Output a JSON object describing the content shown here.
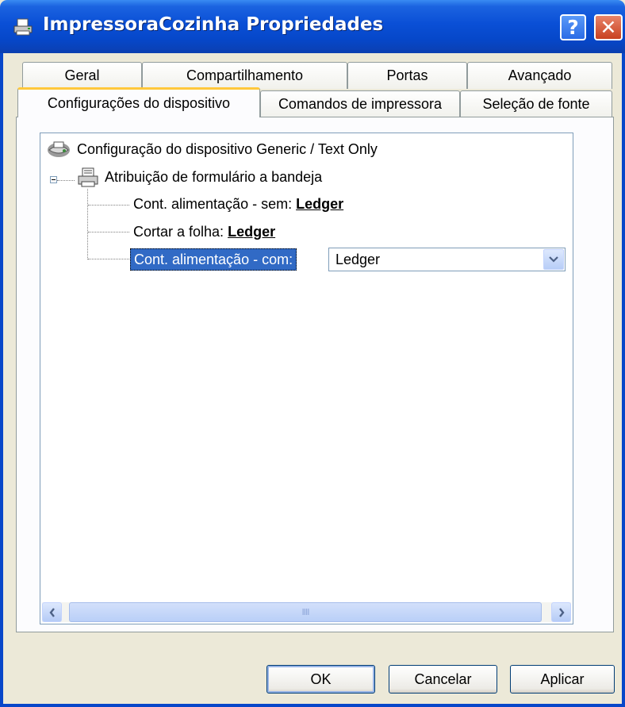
{
  "window": {
    "title": "ImpressoraCozinha Propriedades",
    "help_label": "?",
    "close_label": "✕"
  },
  "tabs": {
    "row_back": [
      {
        "label": "Geral"
      },
      {
        "label": "Compartilhamento"
      },
      {
        "label": "Portas"
      },
      {
        "label": "Avançado"
      }
    ],
    "row_front": [
      {
        "label": "Configurações do dispositivo",
        "active": true
      },
      {
        "label": "Comandos de impressora"
      },
      {
        "label": "Seleção de fonte"
      }
    ]
  },
  "tree": {
    "root": "Configuração do dispositivo Generic / Text Only",
    "node": "Atribuição de formulário a bandeja",
    "items": [
      {
        "label": "Cont. alimentação - sem:",
        "value": "Ledger"
      },
      {
        "label": "Cortar a folha:",
        "value": "Ledger"
      },
      {
        "label": "Cont. alimentação - com:",
        "value": "Ledger"
      }
    ]
  },
  "combo": {
    "value": "Ledger"
  },
  "scrollbar": {
    "thumb_grip": "IIII"
  },
  "buttons": {
    "ok": "OK",
    "cancel": "Cancelar",
    "apply": "Aplicar"
  },
  "colors": {
    "titlebar": "#0a4fd6",
    "window_bg": "#ece9d8",
    "selection": "#316ac5",
    "active_tab_accent": "#ffc83c"
  },
  "icons": [
    "printer-icon",
    "tree-expander-minus-icon",
    "device-settings-icon",
    "chevron-down-icon",
    "arrow-left-icon",
    "arrow-right-icon",
    "help-icon",
    "close-icon"
  ]
}
